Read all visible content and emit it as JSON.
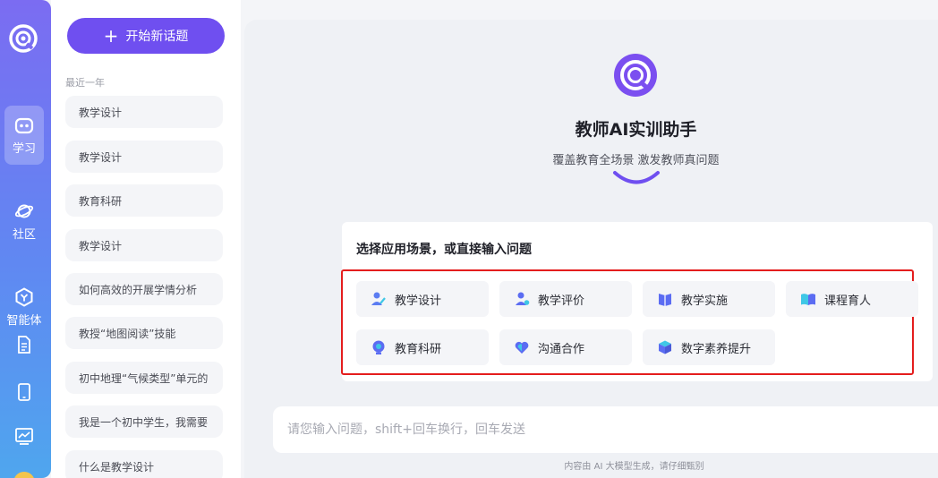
{
  "rail": {
    "items": [
      {
        "icon": "robot-icon",
        "label": "学习",
        "active": true
      },
      {
        "icon": "planet-icon",
        "label": "社区",
        "active": false
      },
      {
        "icon": "agent-hexagon-icon",
        "label": "智能体",
        "active": false
      }
    ],
    "extra_icons": [
      "document-icon",
      "tablet-icon",
      "chart-icon"
    ]
  },
  "sidebar": {
    "new_topic_label": "开始新话题",
    "group_label": "最近一年",
    "history": [
      "教学设计",
      "教学设计",
      "教育科研",
      "教学设计",
      "如何高效的开展学情分析",
      "教授“地图阅读”技能",
      "初中地理“气候类型”单元的",
      "我是一个初中学生，我需要",
      "什么是教学设计"
    ]
  },
  "hero": {
    "title": "教师AI实训助手",
    "subtitle": "覆盖教育全场景 激发教师真问题"
  },
  "scenes": {
    "title": "选择应用场景，或直接输入问题",
    "chips": [
      {
        "label": "教学设计",
        "icon": "teacher-design-icon"
      },
      {
        "label": "教学评价",
        "icon": "evaluation-icon"
      },
      {
        "label": "教学实施",
        "icon": "book-icon"
      },
      {
        "label": "课程育人",
        "icon": "open-book-icon"
      },
      {
        "label": "教育科研",
        "icon": "research-icon"
      },
      {
        "label": "沟通合作",
        "icon": "communication-icon"
      },
      {
        "label": "数字素养提升",
        "icon": "cube-icon"
      }
    ]
  },
  "composer": {
    "placeholder": "请您输入问题，shift+回车换行，回车发送"
  },
  "footnote": "内容由 AI 大模型生成，请仔细甄别",
  "colors": {
    "brand": "#6f4ff0",
    "highlight_box": "#e41d1d"
  }
}
